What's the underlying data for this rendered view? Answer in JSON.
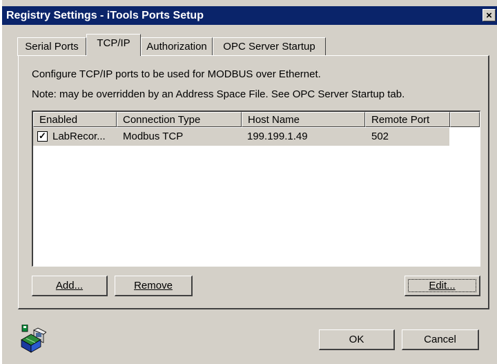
{
  "window": {
    "title": "Registry Settings - iTools Ports Setup",
    "close_label": "×"
  },
  "tabs": [
    {
      "label": "Serial Ports",
      "active": false
    },
    {
      "label": "TCP/IP",
      "active": true
    },
    {
      "label": "Authorization",
      "active": false
    },
    {
      "label": "OPC Server Startup",
      "active": false
    }
  ],
  "panel": {
    "description": "Configure TCP/IP ports to be used for MODBUS over Ethernet.",
    "note": "Note:  may be overridden by an Address Space File.  See OPC Server Startup tab."
  },
  "table": {
    "columns": [
      "Enabled",
      "Connection Type",
      "Host Name",
      "Remote Port",
      ""
    ],
    "rows": [
      {
        "enabled": true,
        "name": "LabRecor...",
        "connection_type": "Modbus TCP",
        "host_name": "199.199.1.49",
        "remote_port": "502",
        "check_mark": "✓"
      }
    ]
  },
  "buttons": {
    "add": "Add...",
    "remove": "Remove",
    "edit": "Edit...",
    "ok": "OK",
    "cancel": "Cancel"
  },
  "icons": {
    "app_icon": "network-computer-icon"
  }
}
